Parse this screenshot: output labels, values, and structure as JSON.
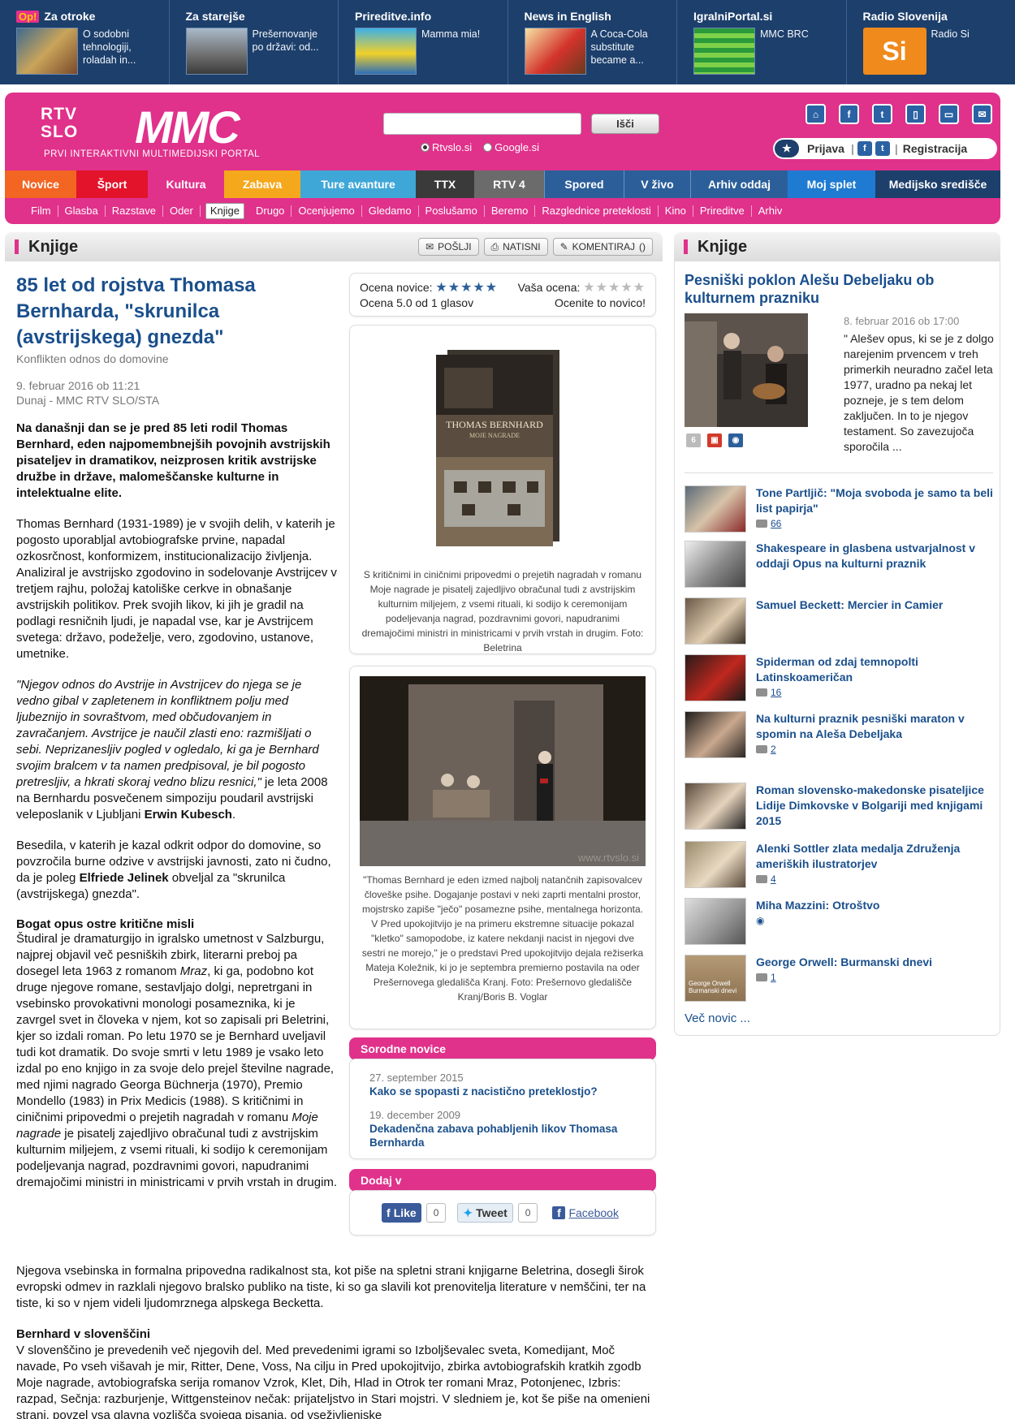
{
  "partners": [
    {
      "title": "Za otroke",
      "logo": "Op!",
      "text": "O sodobni tehnologiji, roladah in..."
    },
    {
      "title": "Za starejše",
      "text": "Prešernovanje po državi: od..."
    },
    {
      "title": "Prireditve.info",
      "text": "Mamma mia!"
    },
    {
      "title": "News in English",
      "text": "A Coca-Cola substitute became a..."
    },
    {
      "title": "IgralniPortal.si",
      "text": "MMC BRC"
    },
    {
      "title": "Radio Slovenija",
      "text": "Radio Si",
      "badge": "Si"
    }
  ],
  "header": {
    "logo_rtv_1": "RTV",
    "logo_rtv_2": "SLO",
    "logo_mmc": "MMC",
    "logo_sub": "PRVI INTERAKTIVNI MULTIMEDIJSKI PORTAL",
    "search_value": "",
    "search_button": "Išči",
    "radio_rtvslo": "Rtvslo.si",
    "radio_google": "Google.si",
    "login": "Prijava",
    "register": "Registracija"
  },
  "main_nav": [
    {
      "label": "Novice",
      "color": "#f26522"
    },
    {
      "label": "Šport",
      "color": "#e2132b"
    },
    {
      "label": "Kultura",
      "color": "#e0318b"
    },
    {
      "label": "Zabava",
      "color": "#f6a81c"
    },
    {
      "label": "Ture avanture",
      "color": "#3fa7d8"
    },
    {
      "label": "TTX",
      "color": "#3a3a3a"
    },
    {
      "label": "RTV 4",
      "color": "#6b6b6b"
    },
    {
      "label": "Spored",
      "color": "#2c5f9a"
    },
    {
      "label": "V živo",
      "color": "#2c5f9a"
    },
    {
      "label": "Arhiv oddaj",
      "color": "#2c5f9a"
    },
    {
      "label": "Moj splet",
      "color": "#1e7bd1"
    },
    {
      "label": "Medijsko središče",
      "color": "#1d3f6b"
    }
  ],
  "sub_nav": [
    "Film",
    "Glasba",
    "Razstave",
    "Oder",
    "Knjige",
    "Drugo",
    "Ocenjujemo",
    "Gledamo",
    "Poslušamo",
    "Beremo",
    "Razglednice preteklosti",
    "Kino",
    "Prireditve",
    "Arhiv"
  ],
  "section": {
    "title": "Knjige",
    "send": "POŠLJI",
    "print": "NATISNI",
    "comment": "KOMENTIRAJ",
    "comment_count": "()"
  },
  "article": {
    "title": "85 let od rojstva Thomasa Bernharda, \"skrunilca (avstrijskega) gnezda\"",
    "subtitle": "Konflikten odnos do domovine",
    "date": "9. februar 2016 ob 11:21",
    "source": "Dunaj - MMC RTV SLO/STA",
    "lead": "Na današnji dan se je pred 85 leti rodil Thomas Bernhard, eden najpomembnejših povojnih avstrijskih pisateljev in dramatikov, neizprosen kritik avstrijske družbe in države, malomeščanske kulturne in intelektualne elite.",
    "p1": "Thomas Bernhard (1931-1989) je v svojih delih, v katerih je pogosto uporabljal avtobiografske prvine, napadal ozkosrčnost, konformizem, institucionalizacijo življenja. Analiziral je avstrijsko zgodovino in sodelovanje Avstrijcev v tretjem rajhu, položaj katoliške cerkve in obnašanje avstrijskih politikov. Prek svojih likov, ki jih je gradil na podlagi resničnih ljudi, je napadal vse, kar je Avstrijcem svetega: državo, podeželje, vero, zgodovino, ustanove, umetnike.",
    "p2_quote": "\"Njegov odnos do Avstrije in Avstrijcev do njega se je vedno gibal v zapletenem in konfliktnem polju med ljubeznijo in sovraštvom, med občudovanjem in zavračanjem. Avstrijce je naučil zlasti eno: razmišljati o sebi. Neprizanesljiv pogled v ogledalo, ki ga je Bernhard svojim bralcem v ta namen predpisoval, je bil pogosto pretresljiv, a hkrati skoraj vedno blizu resnici,\"",
    "p2_rest": " je leta 2008 na Bernhardu posvečenem simpoziju poudaril avstrijski veleposlanik v Ljubljani ",
    "p2_name": "Erwin Kubesch",
    "p3_a": "Besedila, v katerih je kazal odkrit odpor do domovine, so povzročila burne odzive v avstrijski javnosti, zato ni čudno, da je poleg ",
    "p3_name": "Elfriede Jelinek",
    "p3_b": " obveljal za \"skrunilca (avstrijskega) gnezda\".",
    "h1": "Bogat opus ostre kritične misli",
    "p4_a": "Študiral je dramaturgijo in igralsko umetnost v Salzburgu, najprej objavil več pesniških zbirk, literarni preboj pa dosegel leta 1963 z romanom ",
    "p4_mraz": "Mraz",
    "p4_b": ", ki ga, podobno kot druge njegove romane, sestavljajo dolgi, nepretrgani in vsebinsko provokativni monologi posameznika, ki je zavrgel svet in človeka v njem, kot so zapisali pri Beletrini, kjer so izdali roman. Po letu 1970 se je Bernhard uveljavil tudi kot dramatik. Do svoje smrti v letu 1989 je vsako leto izdal po eno knjigo in za svoje delo prejel številne nagrade, med njimi nagrado Georga Büchnerja (1970), Premio Mondello (1983) in Prix Medicis (1988). S kritičnimi in ciničnimi pripovedmi o prejetih nagradah v romanu ",
    "p4_book": "Moje nagrade",
    "p4_c": " je pisatelj zajedljivo obračunal tudi z avstrijskim kulturnim miljejem, z vsemi rituali, ki sodijo k ceremonijam podeljevanja nagrad, pozdravnimi govori, napudranimi dremajočimi ministri in ministricami v prvih vrstah in drugim.",
    "p5": "Njegova vsebinska in formalna pripovedna radikalnost sta, kot piše na spletni strani knjigarne Beletrina, dosegli širok evropski odmev in razklali njegovo bralsko publiko na tiste, ki so ga slavili kot prenovitelja literature v nemščini, ter na tiste, ki so v njem videli ljudomrznega alpskega Becketta.",
    "h2": "Bernhard v slovenščini",
    "p6": "V slovenščino je prevedenih več njegovih del. Med prevedenimi igrami so Izboljševalec sveta, Komedijant, Moč navade, Po vseh višavah je mir, Ritter, Dene, Voss, Na cilju in Pred upokojitvijo, zbirka avtobiografskih kratkih zgodb Moje nagrade, avtobiografska serija romanov Vzrok, Klet, Dih, Hlad in Otrok ter romani Mraz, Potonjenec, Izbris: razpad, Sečnja: razburjenje, Wittgensteinov nečak: prijateljstvo in Stari mojstri. V sledniem je, kot še piše na omenieni strani, povzel vsa glavna vozlišča svojega pisania, od vseživlienjske"
  },
  "rating": {
    "news_label": "Ocena novice:",
    "news_stars": "★★★★★",
    "score_text": "Ocena 5.0 od 1 glasov",
    "your_label": "Vaša ocena:",
    "your_stars": "★★★★★",
    "rate_link": "Ocenite to novico!"
  },
  "figures": [
    {
      "cover_author": "THOMAS BERNHARD",
      "cover_title": "MOJE NAGRADE",
      "caption": "S kritičnimi in ciničnimi pripovedmi o prejetih nagradah v romanu Moje nagrade je pisatelj zajedljivo obračunal tudi z avstrijskim kulturnim miljejem, z vsemi rituali, ki sodijo k ceremonijam podeljevanja nagrad, pozdravnimi govori, napudranimi dremajočimi ministri in ministricami v prvih vrstah in drugim. Foto: Beletrina"
    },
    {
      "watermark": "www.rtvslo.si",
      "caption": "\"Thomas Bernhard je eden izmed najbolj natančnih zapisovalcev človeške psihe. Dogajanje postavi v neki zaprti mentalni prostor, mojstrsko zapiše \"ječo\" posamezne psihe, mentalnega horizonta. V Pred upokojitvijo je na primeru ekstremne situacije pokazal \"kletko\" samopodobe, iz katere nekdanji nacist in njegovi dve sestri ne morejo,\" je o predstavi Pred upokojitvijo dejala režiserka Mateja Koležnik, ki jo je septembra premierno postavila na oder Prešernovega gledališča Kranj. Foto: Prešernovo gledališče Kranj/Boris B. Voglar"
    }
  ],
  "related": {
    "title": "Sorodne novice",
    "items": [
      {
        "date": "27. september 2015",
        "title": "Kako se spopasti z nacistično preteklostjo?"
      },
      {
        "date": "19. december 2009",
        "title": "Dekadenčna zabava pohabljenih likov Thomasa Bernharda"
      }
    ]
  },
  "share": {
    "title": "Dodaj v",
    "like": "Like",
    "like_count": "0",
    "tweet": "Tweet",
    "tweet_count": "0",
    "facebook": "Facebook"
  },
  "sidebar": {
    "title": "Knjige",
    "featured": {
      "title": "Pesniški poklon Alešu Debeljaku ob kulturnem prazniku",
      "date": "8. februar 2016 ob 17:00",
      "text": "\" Alešev opus, ki se je z dolgo narejenim prvencem v treh primerkih neuradno začel leta 1977, uradno pa nekaj let pozneje, je s tem delom zaključen. In to je njegov testament. So zavezujoča sporočila ...",
      "comments": "6"
    },
    "items": [
      {
        "title": "Tone Partljič: \"Moja svoboda je samo ta beli list papirja\"",
        "comments": "66"
      },
      {
        "title": "Shakespeare in glasbena ustvarjalnost v oddaji Opus na kulturni praznik",
        "comments": ""
      },
      {
        "title": "Samuel Beckett: Mercier in Camier",
        "comments": ""
      },
      {
        "title": "Spiderman od zdaj temnopolti Latinskoameričan",
        "comments": "16"
      },
      {
        "title": "Na kulturni praznik pesniški maraton v spomin na Aleša Debeljaka",
        "comments": "2"
      },
      {
        "title": "Roman slovensko-makedonske pisateljice Lidije Dimkovske v Bolgariji med knjigami 2015",
        "comments": ""
      },
      {
        "title": "Alenki Sottler zlata medalja Združenja ameriških ilustratorjev",
        "comments": "4"
      },
      {
        "title": "Miha Mazzini: Otroštvo",
        "comments": ""
      },
      {
        "title": "George Orwell: Burmanski dnevi",
        "comments": "1",
        "thumb_text": "George Orwell Burmanski dnevi"
      }
    ],
    "more": "Več novic ..."
  }
}
